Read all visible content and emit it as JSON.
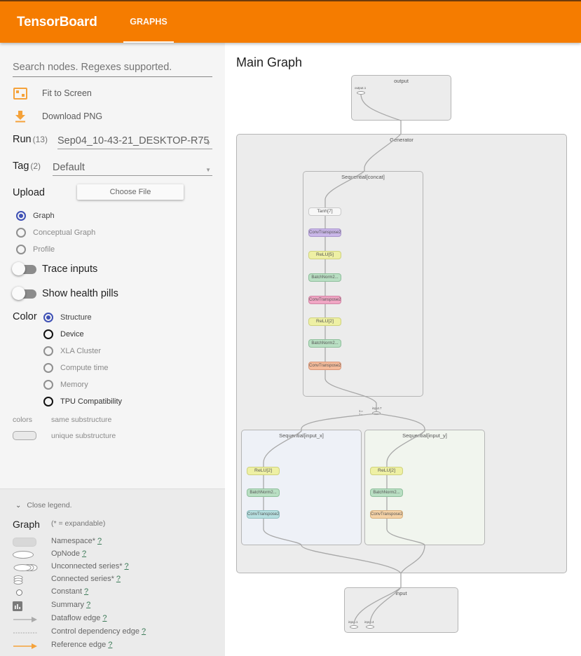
{
  "header": {
    "brand": "TensorBoard",
    "tab": "GRAPHS"
  },
  "colors": {
    "accent": "#f57c00",
    "radio_selected": "#3f51b5"
  },
  "sidebar": {
    "search_placeholder": "Search nodes. Regexes supported.",
    "actions": [
      {
        "icon": "fit-to-screen-icon",
        "label": "Fit to Screen"
      },
      {
        "icon": "download-icon",
        "label": "Download PNG"
      }
    ],
    "run": {
      "label": "Run",
      "count": "(13)",
      "value": "Sep04_10-43-21_DESKTOP-R75"
    },
    "tag": {
      "label": "Tag",
      "count": "(2)",
      "value": "Default"
    },
    "upload": {
      "label": "Upload",
      "button": "Choose File"
    },
    "graph_type": [
      {
        "label": "Graph",
        "selected": true
      },
      {
        "label": "Conceptual Graph",
        "selected": false
      },
      {
        "label": "Profile",
        "selected": false
      }
    ],
    "toggles": [
      {
        "label": "Trace inputs",
        "on": false
      },
      {
        "label": "Show health pills",
        "on": false
      }
    ],
    "color": {
      "label": "Color",
      "options": [
        {
          "label": "Structure",
          "selected": true
        },
        {
          "label": "Device",
          "selected": false
        },
        {
          "label": "XLA Cluster",
          "selected": false
        },
        {
          "label": "Compute time",
          "selected": false
        },
        {
          "label": "Memory",
          "selected": false
        },
        {
          "label": "TPU Compatibility",
          "selected": false
        }
      ]
    },
    "colors_legend": {
      "label": "colors",
      "same": "same substructure",
      "unique": "unique substructure"
    }
  },
  "legend": {
    "close": "Close legend.",
    "title": "Graph",
    "subtitle": "(* = expandable)",
    "help": "?",
    "items": [
      {
        "icon": "namespace-icon",
        "label": "Namespace*"
      },
      {
        "icon": "opnode-icon",
        "label": "OpNode"
      },
      {
        "icon": "unconnected-series-icon",
        "label": "Unconnected series*"
      },
      {
        "icon": "connected-series-icon",
        "label": "Connected series*"
      },
      {
        "icon": "constant-icon",
        "label": "Constant"
      },
      {
        "icon": "summary-icon",
        "label": "Summary"
      },
      {
        "icon": "dataflow-edge-icon",
        "label": "Dataflow edge"
      },
      {
        "icon": "control-dependency-edge-icon",
        "label": "Control dependency edge"
      },
      {
        "icon": "reference-edge-icon",
        "label": "Reference edge"
      }
    ]
  },
  "graph": {
    "title": "Main Graph",
    "output": {
      "label": "output",
      "node": "output.1"
    },
    "generator": {
      "label": "Generator",
      "join_node": "input.7",
      "join_inputs": [
        "1 ▹",
        "1 ▹"
      ]
    },
    "concat": {
      "label": "Sequential[concat]",
      "ops": [
        "Tanh[7]",
        "ConvTranspose2...",
        "ReLU[5]",
        "BatchNorm2...",
        "ConvTranspose2...",
        "ReLU[2]",
        "BatchNorm2...",
        "ConvTranspose2..."
      ]
    },
    "input_x": {
      "label": "Sequential[input_x]",
      "ops": [
        "ReLU[2]",
        "BatchNorm2...",
        "ConvTranspose2..."
      ]
    },
    "input_y": {
      "label": "Sequential[input_y]",
      "ops": [
        "ReLU[2]",
        "BatchNorm2...",
        "ConvTranspose2..."
      ]
    },
    "input": {
      "label": "input",
      "nodes": [
        "input.1",
        "input.4"
      ]
    }
  }
}
